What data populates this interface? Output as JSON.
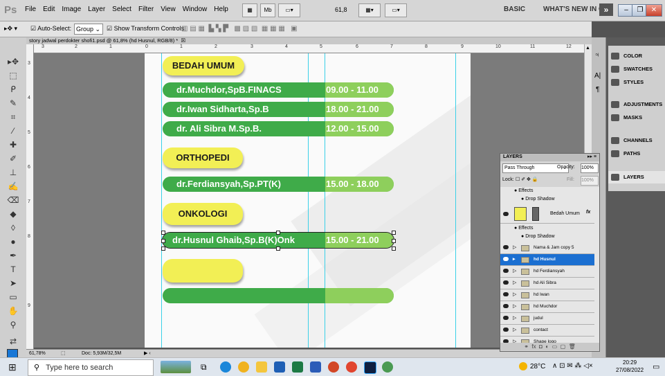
{
  "app": {
    "logo": "Ps",
    "menu": [
      "File",
      "Edit",
      "Image",
      "Layer",
      "Select",
      "Filter",
      "View",
      "Window",
      "Help"
    ],
    "zoom": "61,8",
    "workspace": "BASIC",
    "whats_new": "WHAT'S NEW IN CSS",
    "chevron": "»"
  },
  "options": {
    "auto_select_label": "Auto-Select:",
    "auto_select_value": "Group",
    "show_transform": "Show Transform Controls"
  },
  "document": {
    "tab_title": "story jadwal perdokter shofi1.psd @ 61,8% (hd Husnul, RGB/8) *",
    "ruler_top": [
      "3",
      "2",
      "1",
      "0",
      "1",
      "2",
      "3",
      "4",
      "5",
      "6",
      "7",
      "8",
      "9",
      "10",
      "11",
      "12"
    ],
    "ruler_left": [
      "3",
      "4",
      "5",
      "6",
      "7",
      "8",
      "9"
    ],
    "status_zoom": "61,78%",
    "status_doc": "Doc: 5,93M/32,5M"
  },
  "schedule": {
    "sections": [
      {
        "title": "BEDAH UMUM",
        "doctors": [
          {
            "name": "dr.Muchdor,SpB.FINACS",
            "time": "09.00 - 11.00"
          },
          {
            "name": "dr.Iwan Sidharta,Sp.B",
            "time": "18.00 - 21.00"
          },
          {
            "name": "dr. Ali Sibra M.Sp.B.",
            "time": "12.00 - 15.00"
          }
        ]
      },
      {
        "title": "ORTHOPEDI",
        "doctors": [
          {
            "name": "dr.Ferdiansyah,Sp.PT(K)",
            "time": "15.00 - 18.00"
          }
        ]
      },
      {
        "title": "ONKOLOGI",
        "doctors": [
          {
            "name": "dr.Husnul Ghaib,Sp.B(K)Onk",
            "time": "15.00 - 21.00"
          }
        ]
      }
    ]
  },
  "panels": {
    "top": [
      {
        "label": "COLOR",
        "icon": "color-icon"
      },
      {
        "label": "SWATCHES",
        "icon": "swatches-icon"
      },
      {
        "label": "STYLES",
        "icon": "styles-icon"
      },
      {
        "label": "ADJUSTMENTS",
        "icon": "adjustments-icon"
      },
      {
        "label": "MASKS",
        "icon": "masks-icon"
      },
      {
        "label": "CHANNELS",
        "icon": "channels-icon"
      },
      {
        "label": "PATHS",
        "icon": "paths-icon"
      },
      {
        "label": "LAYERS",
        "icon": "layers-icon"
      }
    ]
  },
  "layers": {
    "title": "LAYERS",
    "blend": "Pass Through",
    "opacity_label": "Opacity:",
    "opacity": "100%",
    "lock_label": "Lock:",
    "fill_label": "Fill:",
    "fill": "100%",
    "effects_label": "Effects",
    "drop_shadow": "Drop Shadow",
    "bedah_layer": "Bedah Umum",
    "rows": [
      "Nama & Jam copy 5",
      "hd Husnul",
      "hd Ferdiansyah",
      "hd Ali Sibra",
      "hd Iwan",
      "hd Muchdor",
      "judul",
      "contact",
      "Shape logo"
    ],
    "selected_index": 1
  },
  "taskbar": {
    "search_placeholder": "Type here to search",
    "weather": "28°C",
    "time": "20:29",
    "date": "27/08/2022"
  },
  "colors": {
    "green": "#3fab49",
    "light_green": "#8ecf5c",
    "yellow": "#f2ef55",
    "guide": "#39d0e8",
    "selected_layer": "#1b6fd1"
  }
}
